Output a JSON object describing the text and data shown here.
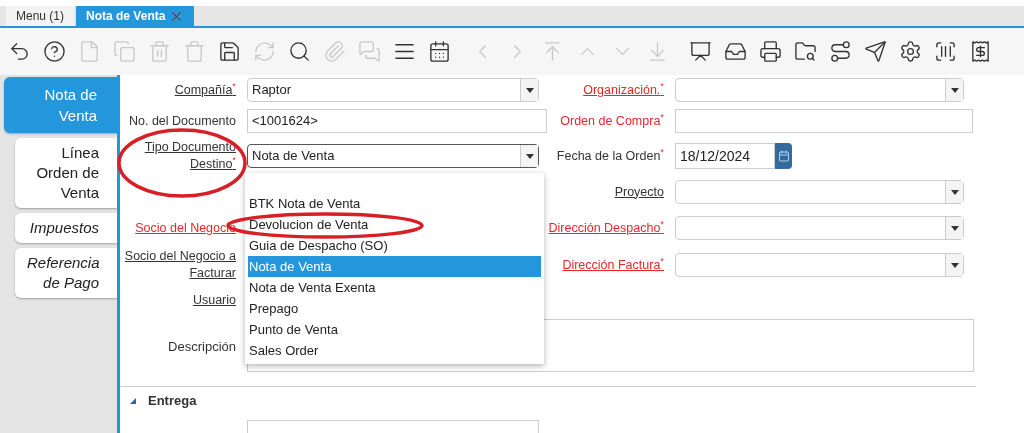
{
  "tabs": [
    {
      "label": "Menu (1)",
      "selected": false,
      "closable": false
    },
    {
      "label": "Nota de Venta",
      "selected": true,
      "closable": true
    }
  ],
  "toolbar": [
    {
      "kind": "undo",
      "disabled": false
    },
    {
      "kind": "help",
      "disabled": false
    },
    {
      "kind": "new",
      "disabled": true
    },
    {
      "kind": "copy",
      "disabled": true
    },
    {
      "kind": "delete",
      "disabled": true
    },
    {
      "kind": "delete_selection",
      "disabled": true
    },
    {
      "kind": "save",
      "disabled": false
    },
    {
      "kind": "refresh",
      "disabled": true
    },
    {
      "kind": "search",
      "disabled": false
    },
    {
      "kind": "attach",
      "disabled": true
    },
    {
      "kind": "chat",
      "disabled": true
    },
    {
      "kind": "grid",
      "disabled": false
    },
    {
      "kind": "calendar",
      "disabled": false
    },
    {
      "kind": "previous",
      "disabled": true
    },
    {
      "kind": "next",
      "disabled": true
    },
    {
      "kind": "first",
      "disabled": true
    },
    {
      "kind": "up",
      "disabled": true
    },
    {
      "kind": "down",
      "disabled": true
    },
    {
      "kind": "last",
      "disabled": true
    },
    {
      "kind": "report",
      "disabled": false
    },
    {
      "kind": "archive",
      "disabled": false
    },
    {
      "kind": "print",
      "disabled": false
    },
    {
      "kind": "zoom",
      "disabled": false
    },
    {
      "kind": "workflow",
      "disabled": false
    },
    {
      "kind": "send",
      "disabled": false
    },
    {
      "kind": "process",
      "disabled": false
    },
    {
      "kind": "barcode",
      "disabled": false
    },
    {
      "kind": "receipt",
      "disabled": false
    }
  ],
  "side_tabs": [
    {
      "label": "Nota de Venta",
      "selected": true,
      "italic": false
    },
    {
      "label": "Línea Orden de Venta",
      "selected": false,
      "italic": false
    },
    {
      "label": "Impuestos",
      "selected": false,
      "italic": true
    },
    {
      "label": "Referencia de Pago",
      "selected": false,
      "italic": true
    }
  ],
  "rows": [
    {
      "left": {
        "label": "Compañía",
        "required_mark": "*",
        "highlighted": false,
        "link": true,
        "input": {
          "kind": "combo",
          "value": "Raptor"
        }
      },
      "right": {
        "label": "Organización.",
        "required_mark": "*",
        "highlighted": true,
        "link": true,
        "input": {
          "kind": "combo"
        }
      }
    },
    {
      "left": {
        "label": "No. del Documento",
        "highlighted": false,
        "link": false,
        "input": {
          "kind": "text",
          "value": "<1001624>"
        }
      },
      "right": {
        "label": "Orden de Compra",
        "required_mark": "*",
        "highlighted": true,
        "link": false,
        "input": {
          "kind": "text"
        }
      }
    },
    {
      "left": {
        "label": "Tipo Documento Destino",
        "required_mark": "*",
        "highlighted": false,
        "link": true,
        "input": {
          "kind": "combo",
          "value": "Nota de Venta",
          "open": true,
          "options": [
            {
              "label": "BTK Nota de Venta",
              "selected": false
            },
            {
              "label": "Devolucion de Venta",
              "selected": false
            },
            {
              "label": "Guia de Despacho (SO)",
              "selected": false
            },
            {
              "label": "Nota de Venta",
              "selected": true
            },
            {
              "label": "Nota de Venta Exenta",
              "selected": false
            },
            {
              "label": "Prepago",
              "selected": false
            },
            {
              "label": "Punto de Venta",
              "selected": false
            },
            {
              "label": "Sales Order",
              "selected": false
            }
          ]
        }
      },
      "right": {
        "label": "Fecha de la Orden",
        "required_mark": "*",
        "highlighted": false,
        "link": false,
        "input": {
          "kind": "date",
          "value": "18/12/2024"
        }
      }
    },
    {
      "right": {
        "label": "Proyecto",
        "highlighted": false,
        "link": true,
        "input": {
          "kind": "combo"
        }
      }
    },
    {
      "left": {
        "label": "Socio del Negocio",
        "highlighted": true,
        "link": true
      },
      "right": {
        "label": "Dirección Despacho",
        "required_mark": "*",
        "highlighted": true,
        "link": true,
        "input": {
          "kind": "combo"
        }
      }
    },
    {
      "left": {
        "label": "Socio del Negocio a Facturar",
        "highlighted": false,
        "link": true
      },
      "right": {
        "label": "Dirección Factura",
        "required_mark": "*",
        "highlighted": true,
        "link": true,
        "input": {
          "kind": "combo"
        }
      }
    },
    {
      "left": {
        "label": "Usuario",
        "highlighted": false,
        "link": true
      }
    }
  ],
  "description": {
    "label": "Descripción"
  },
  "section": {
    "title": "Entrega",
    "expanded": true
  },
  "annotations": [
    {
      "kind": "ellipse"
    },
    {
      "kind": "ellipse"
    }
  ]
}
